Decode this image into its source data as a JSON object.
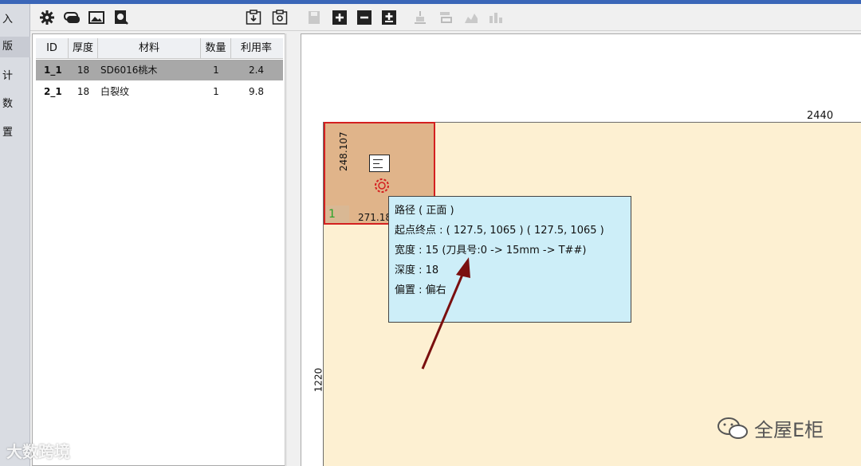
{
  "nav": {
    "items": [
      {
        "label": "导入",
        "visible": "入"
      },
      {
        "label": "排版",
        "visible": "版"
      },
      {
        "label": "统计",
        "visible": "计"
      },
      {
        "label": "参数",
        "visible": "数"
      },
      {
        "label": "设置",
        "visible": "置"
      }
    ]
  },
  "toolbar": {
    "icons": [
      "gear-icon",
      "labels-icon",
      "image-icon",
      "search-doc-icon",
      "import-board-icon",
      "export-board-icon",
      "save-icon",
      "zoom-in-icon",
      "zoom-out-icon",
      "fit-icon",
      "align-bottom-icon",
      "align-top-icon",
      "chart-icon",
      "chart-bar-icon"
    ]
  },
  "parts_table": {
    "headers": {
      "id": "ID",
      "thickness": "厚度",
      "material": "材料",
      "quantity": "数量",
      "usage": "利用率"
    },
    "rows": [
      {
        "id": "1_1",
        "thickness": "18",
        "material": "SD6016桃木",
        "quantity": "1",
        "usage": "2.4",
        "selected": true
      },
      {
        "id": "2_1",
        "thickness": "18",
        "material": "白裂纹",
        "quantity": "1",
        "usage": "9.8",
        "selected": false
      }
    ]
  },
  "canvas": {
    "board_width": "2440",
    "board_height": "1220",
    "part": {
      "number": "1",
      "width_dim": "248.107",
      "length_dim": "271.18"
    },
    "colors": {
      "board": "#fdf0d2",
      "part": "#e0b48a",
      "part_border": "#d42020",
      "tooltip": "#cdeef8",
      "arrow": "#7a0f0f"
    }
  },
  "tooltip": {
    "line1": "路径 ( 正面 )",
    "line2": "起点终点 : ( 127.5, 1065 ) ( 127.5, 1065 )",
    "line3": "宽度 : 15 (刀具号:0 -> 15mm -> T##)",
    "line4": "深度 : 18",
    "line5": "偏置 : 偏右"
  },
  "watermark": {
    "left": "大数跨境",
    "right": "全屋E柜"
  }
}
